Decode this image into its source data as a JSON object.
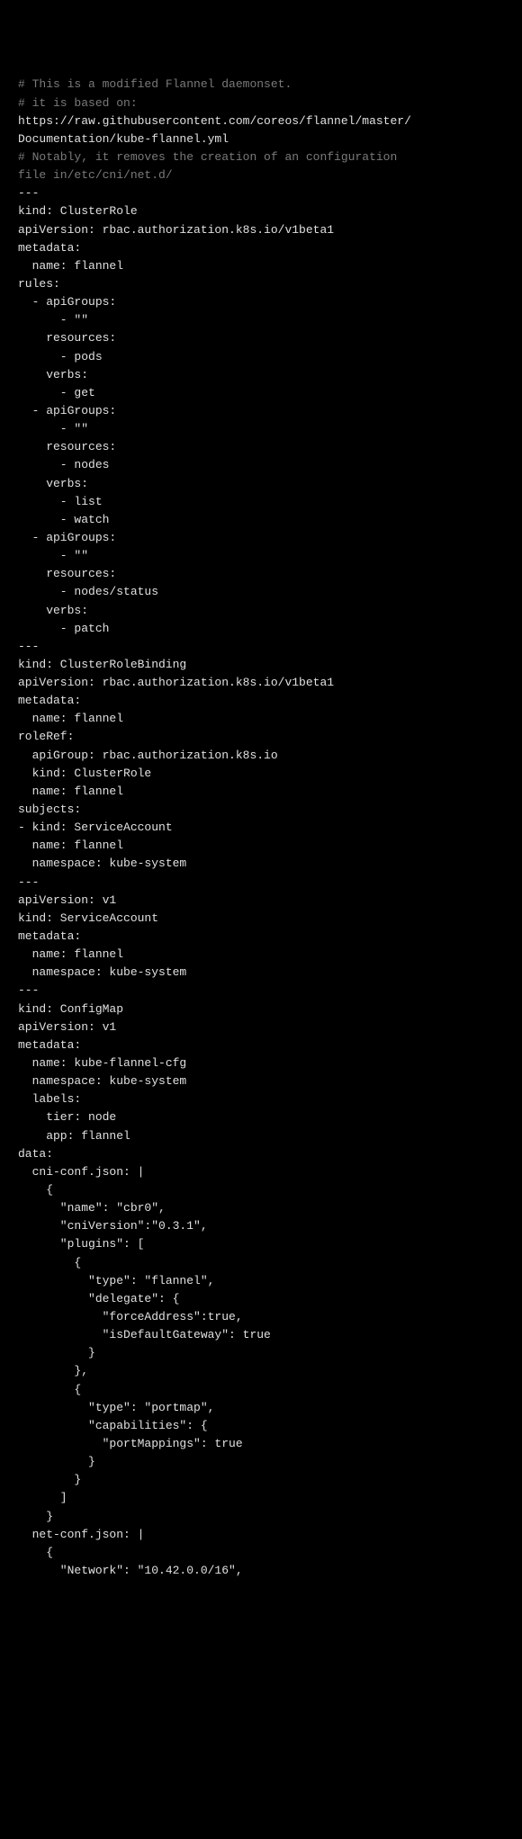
{
  "document": {
    "lines": [
      {
        "text": "# This is a modified Flannel daemonset.",
        "cls": "comment"
      },
      {
        "text": "# it is based on:",
        "cls": "comment"
      },
      {
        "text": "https://raw.githubusercontent.com/coreos/flannel/master/Documentation/kube-flannel.yml",
        "cls": ""
      },
      {
        "text": "# Notably, it removes the creation of an configuration file in/etc/cni/net.d/",
        "cls": "comment"
      },
      {
        "text": "---",
        "cls": ""
      },
      {
        "text": "kind: ClusterRole",
        "cls": ""
      },
      {
        "text": "apiVersion: rbac.authorization.k8s.io/v1beta1",
        "cls": ""
      },
      {
        "text": "metadata:",
        "cls": ""
      },
      {
        "text": "  name: flannel",
        "cls": ""
      },
      {
        "text": "rules:",
        "cls": ""
      },
      {
        "text": "  - apiGroups:",
        "cls": ""
      },
      {
        "text": "      - \"\"",
        "cls": ""
      },
      {
        "text": "    resources:",
        "cls": ""
      },
      {
        "text": "      - pods",
        "cls": ""
      },
      {
        "text": "    verbs:",
        "cls": ""
      },
      {
        "text": "      - get",
        "cls": ""
      },
      {
        "text": "  - apiGroups:",
        "cls": ""
      },
      {
        "text": "      - \"\"",
        "cls": ""
      },
      {
        "text": "    resources:",
        "cls": ""
      },
      {
        "text": "      - nodes",
        "cls": ""
      },
      {
        "text": "    verbs:",
        "cls": ""
      },
      {
        "text": "      - list",
        "cls": ""
      },
      {
        "text": "      - watch",
        "cls": ""
      },
      {
        "text": "  - apiGroups:",
        "cls": ""
      },
      {
        "text": "      - \"\"",
        "cls": ""
      },
      {
        "text": "    resources:",
        "cls": ""
      },
      {
        "text": "      - nodes/status",
        "cls": ""
      },
      {
        "text": "    verbs:",
        "cls": ""
      },
      {
        "text": "      - patch",
        "cls": ""
      },
      {
        "text": "---",
        "cls": ""
      },
      {
        "text": "kind: ClusterRoleBinding",
        "cls": ""
      },
      {
        "text": "apiVersion: rbac.authorization.k8s.io/v1beta1",
        "cls": ""
      },
      {
        "text": "metadata:",
        "cls": ""
      },
      {
        "text": "  name: flannel",
        "cls": ""
      },
      {
        "text": "roleRef:",
        "cls": ""
      },
      {
        "text": "  apiGroup: rbac.authorization.k8s.io",
        "cls": ""
      },
      {
        "text": "  kind: ClusterRole",
        "cls": ""
      },
      {
        "text": "  name: flannel",
        "cls": ""
      },
      {
        "text": "subjects:",
        "cls": ""
      },
      {
        "text": "- kind: ServiceAccount",
        "cls": ""
      },
      {
        "text": "  name: flannel",
        "cls": ""
      },
      {
        "text": "  namespace: kube-system",
        "cls": ""
      },
      {
        "text": "---",
        "cls": ""
      },
      {
        "text": "apiVersion: v1",
        "cls": ""
      },
      {
        "text": "kind: ServiceAccount",
        "cls": ""
      },
      {
        "text": "metadata:",
        "cls": ""
      },
      {
        "text": "  name: flannel",
        "cls": ""
      },
      {
        "text": "  namespace: kube-system",
        "cls": ""
      },
      {
        "text": "---",
        "cls": ""
      },
      {
        "text": "kind: ConfigMap",
        "cls": ""
      },
      {
        "text": "apiVersion: v1",
        "cls": ""
      },
      {
        "text": "metadata:",
        "cls": ""
      },
      {
        "text": "  name: kube-flannel-cfg",
        "cls": ""
      },
      {
        "text": "  namespace: kube-system",
        "cls": ""
      },
      {
        "text": "  labels:",
        "cls": ""
      },
      {
        "text": "    tier: node",
        "cls": ""
      },
      {
        "text": "    app: flannel",
        "cls": ""
      },
      {
        "text": "data:",
        "cls": ""
      },
      {
        "text": "  cni-conf.json: |",
        "cls": ""
      },
      {
        "text": "    {",
        "cls": ""
      },
      {
        "text": "      \"name\": \"cbr0\",",
        "cls": ""
      },
      {
        "text": "      \"cniVersion\":\"0.3.1\",",
        "cls": ""
      },
      {
        "text": "      \"plugins\": [",
        "cls": ""
      },
      {
        "text": "        {",
        "cls": ""
      },
      {
        "text": "          \"type\": \"flannel\",",
        "cls": ""
      },
      {
        "text": "          \"delegate\": {",
        "cls": ""
      },
      {
        "text": "            \"forceAddress\":true,",
        "cls": ""
      },
      {
        "text": "            \"isDefaultGateway\": true",
        "cls": ""
      },
      {
        "text": "          }",
        "cls": ""
      },
      {
        "text": "        },",
        "cls": ""
      },
      {
        "text": "        {",
        "cls": ""
      },
      {
        "text": "          \"type\": \"portmap\",",
        "cls": ""
      },
      {
        "text": "          \"capabilities\": {",
        "cls": ""
      },
      {
        "text": "            \"portMappings\": true",
        "cls": ""
      },
      {
        "text": "          }",
        "cls": ""
      },
      {
        "text": "        }",
        "cls": ""
      },
      {
        "text": "      ]",
        "cls": ""
      },
      {
        "text": "    }",
        "cls": ""
      },
      {
        "text": "  net-conf.json: |",
        "cls": ""
      },
      {
        "text": "    {",
        "cls": ""
      },
      {
        "text": "      \"Network\": \"10.42.0.0/16\",",
        "cls": ""
      }
    ]
  }
}
